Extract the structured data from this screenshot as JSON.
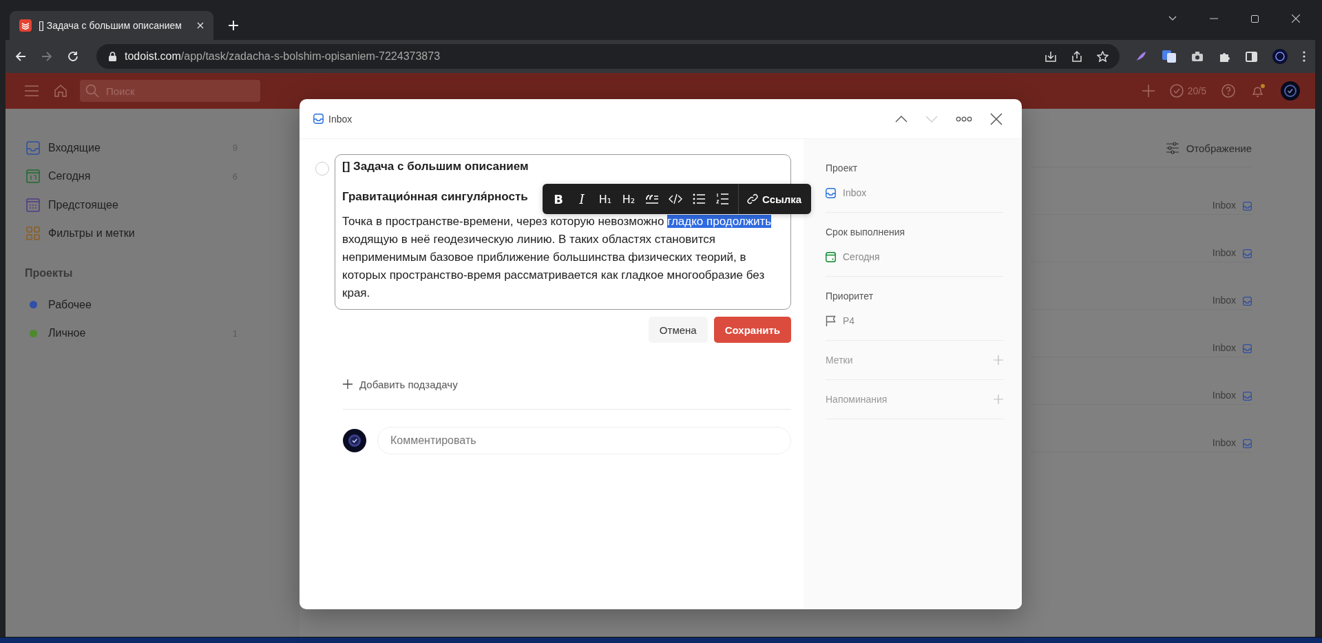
{
  "browser": {
    "tab_title": "[] Задача с большим описанием",
    "url_host": "todoist.com",
    "url_path": "/app/task/zadacha-s-bolshim-opisaniem-7224373873"
  },
  "header": {
    "search": {
      "placeholder": "Поиск"
    },
    "karma": "20/5",
    "notification_dot": true
  },
  "sidebar": {
    "items": [
      {
        "kind": "inbox",
        "label": "Входящие",
        "count": "9"
      },
      {
        "kind": "today",
        "label": "Сегодня",
        "count": "6"
      },
      {
        "kind": "upcoming",
        "label": "Предстоящее"
      },
      {
        "kind": "filters",
        "label": "Фильтры и метки"
      }
    ],
    "projects_title": "Проекты",
    "projects": [
      {
        "label": "Рабочее",
        "color": "#2f4fa8"
      },
      {
        "label": "Личное",
        "color": "#4c8a2c",
        "count": "1"
      }
    ]
  },
  "main": {
    "view_button": "Отображение",
    "rows": [
      {
        "project": "Inbox"
      },
      {
        "project": "Inbox"
      },
      {
        "project": "Inbox"
      },
      {
        "project": "Inbox"
      },
      {
        "project": "Inbox"
      },
      {
        "project": "Inbox"
      }
    ]
  },
  "modal": {
    "breadcrumb": "Inbox",
    "nav": {
      "previous_disabled": false,
      "next_disabled": true
    },
    "task": {
      "checked": false,
      "title": "[] Задача с большим описанием",
      "heading": "Гравитацио́нная сингуля́рность",
      "description": [
        {
          "text": "Точка в пространстве-времени, через которую невозможно ",
          "selected": false
        },
        {
          "text": "гладко продолжить",
          "selected": true
        },
        {
          "text": " входящую в неё геодезическую линию. В таких областях становится неприменимым базовое приближение большинства физических теорий, в которых пространство-время рассматривается как гладкое многообразие без края.",
          "selected": false
        }
      ]
    },
    "format_toolbar": [
      {
        "kind": "bold",
        "label": "B"
      },
      {
        "kind": "italic",
        "label": "I"
      },
      {
        "kind": "heading",
        "label": "H₁"
      },
      {
        "kind": "heading",
        "label": "H₂"
      },
      {
        "kind": "quote"
      },
      {
        "kind": "code"
      },
      {
        "kind": "bullets"
      },
      {
        "kind": "numbered"
      },
      {
        "kind": "link",
        "label": "Ссылка"
      }
    ],
    "buttons": {
      "cancel": "Отмена",
      "save": "Сохранить"
    },
    "add_subtask": "Добавить подзадачу",
    "comment": {
      "placeholder": "Комментировать"
    },
    "details": [
      {
        "kind": "project",
        "label": "Проект",
        "value": "Inbox"
      },
      {
        "kind": "date",
        "label": "Срок выполнения",
        "value": "Сегодня"
      },
      {
        "kind": "priority",
        "label": "Приоритет",
        "value": "P4"
      },
      {
        "kind": "add",
        "label": "Метки"
      },
      {
        "kind": "add",
        "label": "Напоминания"
      }
    ]
  }
}
